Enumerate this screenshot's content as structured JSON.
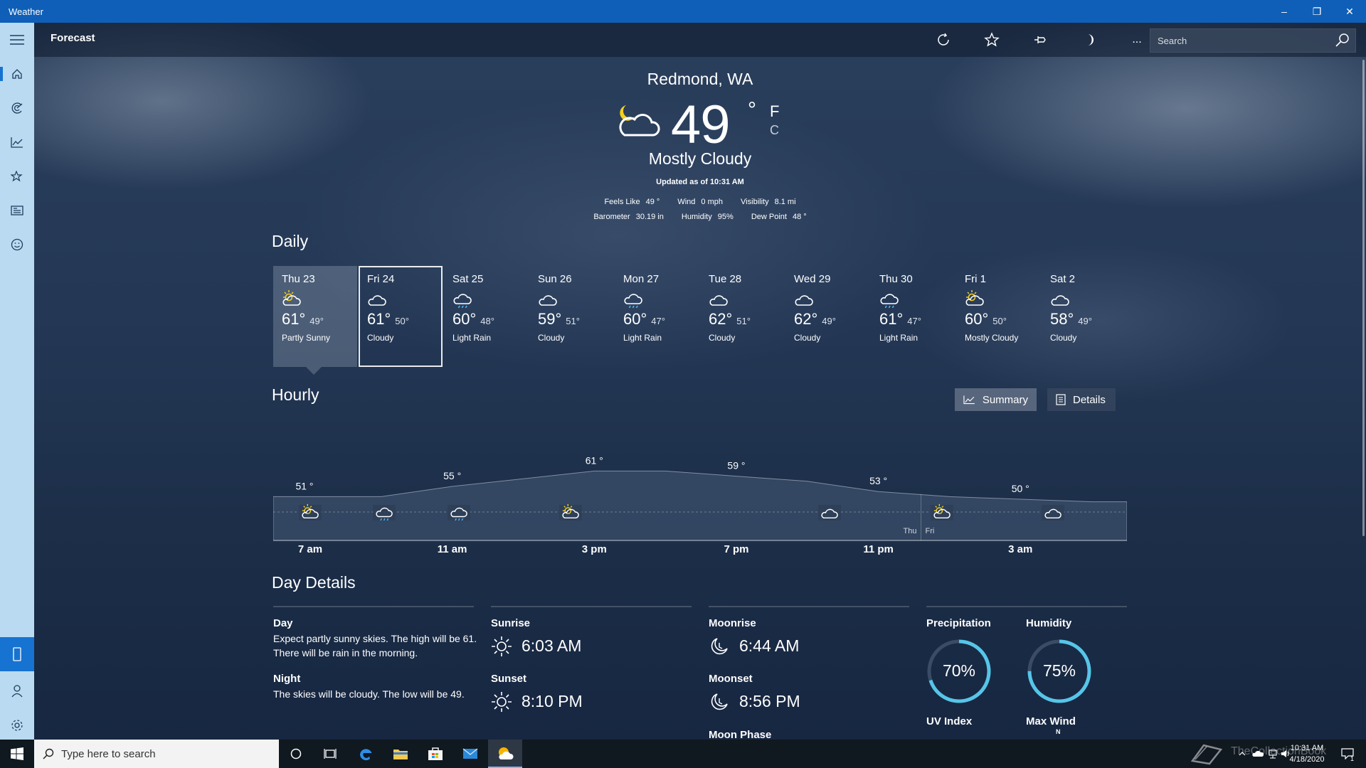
{
  "window": {
    "title": "Weather",
    "minimize": "–",
    "restore": "❐",
    "close": "✕"
  },
  "commandbar": {
    "title": "Forecast",
    "search_placeholder": "Search",
    "more": "..."
  },
  "current": {
    "location": "Redmond, WA",
    "temperature": "49",
    "degree": "°",
    "unit_f": "F",
    "unit_c": "C",
    "condition": "Mostly Cloudy",
    "updated": "Updated as of 10:31 AM",
    "stats_row1": [
      {
        "label": "Feels Like",
        "value": "49 °"
      },
      {
        "label": "Wind",
        "value": "0 mph"
      },
      {
        "label": "Visibility",
        "value": "8.1 mi"
      }
    ],
    "stats_row2": [
      {
        "label": "Barometer",
        "value": "30.19 in"
      },
      {
        "label": "Humidity",
        "value": "95%"
      },
      {
        "label": "Dew Point",
        "value": "48 °"
      }
    ]
  },
  "daily": {
    "title": "Daily",
    "days": [
      {
        "name": "Thu 23",
        "hi": "61°",
        "lo": "49°",
        "cond": "Partly Sunny",
        "icon": "partly-sunny-icon"
      },
      {
        "name": "Fri 24",
        "hi": "61°",
        "lo": "50°",
        "cond": "Cloudy",
        "icon": "cloudy-icon"
      },
      {
        "name": "Sat 25",
        "hi": "60°",
        "lo": "48°",
        "cond": "Light Rain",
        "icon": "light-rain-icon"
      },
      {
        "name": "Sun 26",
        "hi": "59°",
        "lo": "51°",
        "cond": "Cloudy",
        "icon": "cloudy-icon"
      },
      {
        "name": "Mon 27",
        "hi": "60°",
        "lo": "47°",
        "cond": "Light Rain",
        "icon": "light-rain-icon"
      },
      {
        "name": "Tue 28",
        "hi": "62°",
        "lo": "51°",
        "cond": "Cloudy",
        "icon": "cloudy-icon"
      },
      {
        "name": "Wed 29",
        "hi": "62°",
        "lo": "49°",
        "cond": "Cloudy",
        "icon": "cloudy-icon"
      },
      {
        "name": "Thu 30",
        "hi": "61°",
        "lo": "47°",
        "cond": "Light Rain",
        "icon": "light-rain-icon"
      },
      {
        "name": "Fri 1",
        "hi": "60°",
        "lo": "50°",
        "cond": "Mostly Cloudy",
        "icon": "mostly-cloudy-icon"
      },
      {
        "name": "Sat 2",
        "hi": "58°",
        "lo": "49°",
        "cond": "Cloudy",
        "icon": "cloudy-icon"
      }
    ]
  },
  "hourly": {
    "title": "Hourly",
    "summary_label": "Summary",
    "details_label": "Details",
    "temp_labels": [
      "51 °",
      "55 °",
      "61 °",
      "59 °",
      "53 °",
      "50 °"
    ],
    "time_labels": [
      "7 am",
      "11 am",
      "3 pm",
      "7 pm",
      "11 pm",
      "3 am"
    ],
    "day_divider": {
      "before": "Thu",
      "after": "Fri"
    }
  },
  "chart_data": {
    "type": "area",
    "title": "",
    "xlabel": "",
    "ylabel": "",
    "x": [
      "7 am",
      "9 am",
      "11 am",
      "1 pm",
      "3 pm",
      "5 pm",
      "7 pm",
      "9 pm",
      "11 pm",
      "1 am",
      "3 am",
      "5 am"
    ],
    "series": [
      {
        "values": [
          51,
          51,
          55,
          58,
          61,
          61,
          59,
          57,
          53,
          51,
          50,
          49
        ]
      }
    ],
    "labeled_points": [
      {
        "x": "7 am",
        "y": 51
      },
      {
        "x": "11 am",
        "y": 55
      },
      {
        "x": "3 pm",
        "y": 61
      },
      {
        "x": "7 pm",
        "y": 59
      },
      {
        "x": "11 pm",
        "y": 53
      },
      {
        "x": "3 am",
        "y": 50
      }
    ],
    "grid": false,
    "legend": "none"
  },
  "day_details": {
    "title": "Day Details",
    "day_label": "Day",
    "day_text": "Expect partly sunny skies. The high will be 61. There will be rain in the morning.",
    "night_label": "Night",
    "night_text": "The skies will be cloudy. The low will be 49.",
    "sunrise_label": "Sunrise",
    "sunrise": "6:03 AM",
    "sunset_label": "Sunset",
    "sunset": "8:10 PM",
    "moonrise_label": "Moonrise",
    "moonrise": "6:44 AM",
    "moonset_label": "Moonset",
    "moonset": "8:56 PM",
    "moon_phase_label": "Moon Phase",
    "precipitation_label": "Precipitation",
    "precipitation": "70%",
    "precipitation_fraction": 0.7,
    "humidity_label": "Humidity",
    "humidity": "75%",
    "humidity_fraction": 0.75,
    "uv_label": "UV Index",
    "wind_label": "Max Wind",
    "wind_dir": "N"
  },
  "taskbar": {
    "search_placeholder": "Type here to search",
    "time": "10:31 AM",
    "date": "4/18/2020",
    "watermark": "TheCollectionBook",
    "notification_count": "1"
  },
  "colors": {
    "titlebar": "#0f5fb8",
    "rail": "#b9daf0",
    "accent": "#1673d1",
    "ring": "#56c5e8"
  }
}
